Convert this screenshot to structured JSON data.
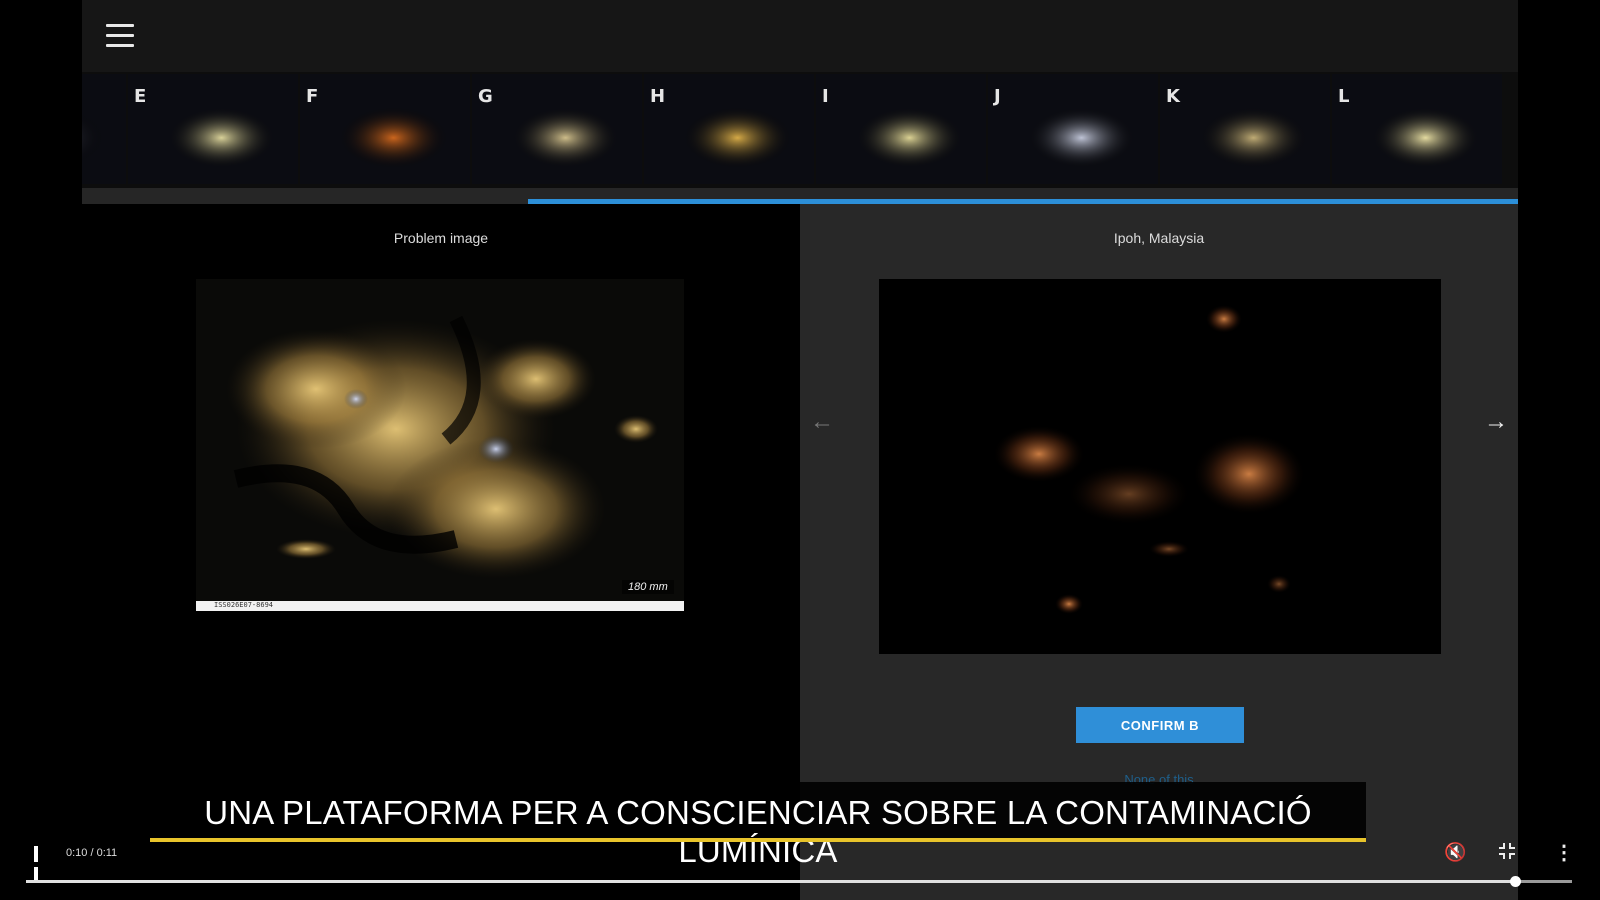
{
  "header": {
    "menu_icon": "hamburger-menu-icon"
  },
  "thumbnails": [
    {
      "letter": "",
      "tone": "#5a5a6a"
    },
    {
      "letter": "E",
      "tone": "#e4dca0"
    },
    {
      "letter": "F",
      "tone": "#d56a1e"
    },
    {
      "letter": "G",
      "tone": "#d8c690"
    },
    {
      "letter": "H",
      "tone": "#e0b24a"
    },
    {
      "letter": "I",
      "tone": "#e6dc9a"
    },
    {
      "letter": "J",
      "tone": "#c8cde0"
    },
    {
      "letter": "K",
      "tone": "#c9b47a"
    },
    {
      "letter": "L",
      "tone": "#f0e6a8"
    }
  ],
  "strip_progress": 0.69,
  "left_panel": {
    "title": "Problem image",
    "image_id": "ISS026E07-8694",
    "focal_length": "180 mm"
  },
  "right_panel": {
    "title": "Ipoh, Malaysia",
    "confirm_label": "CONFIRM B",
    "none_label": "None of this",
    "prev_icon": "arrow-left-icon",
    "next_icon": "arrow-right-icon"
  },
  "caption": {
    "text": "UNA PLATAFORMA PER A CONSCIENCIAR SOBRE LA CONTAMINACIÓ LUMÍNICA",
    "underline_color": "#e8c42b"
  },
  "player": {
    "time": "0:10 / 0:11",
    "progress": 0.96,
    "pause_icon": "pause-icon",
    "mute_icon": "volume-muted-icon",
    "fullscreen_icon": "exit-fullscreen-icon",
    "more_icon": "more-vertical-icon"
  },
  "colors": {
    "accent": "#2f8fd8",
    "panel": "#282828"
  }
}
